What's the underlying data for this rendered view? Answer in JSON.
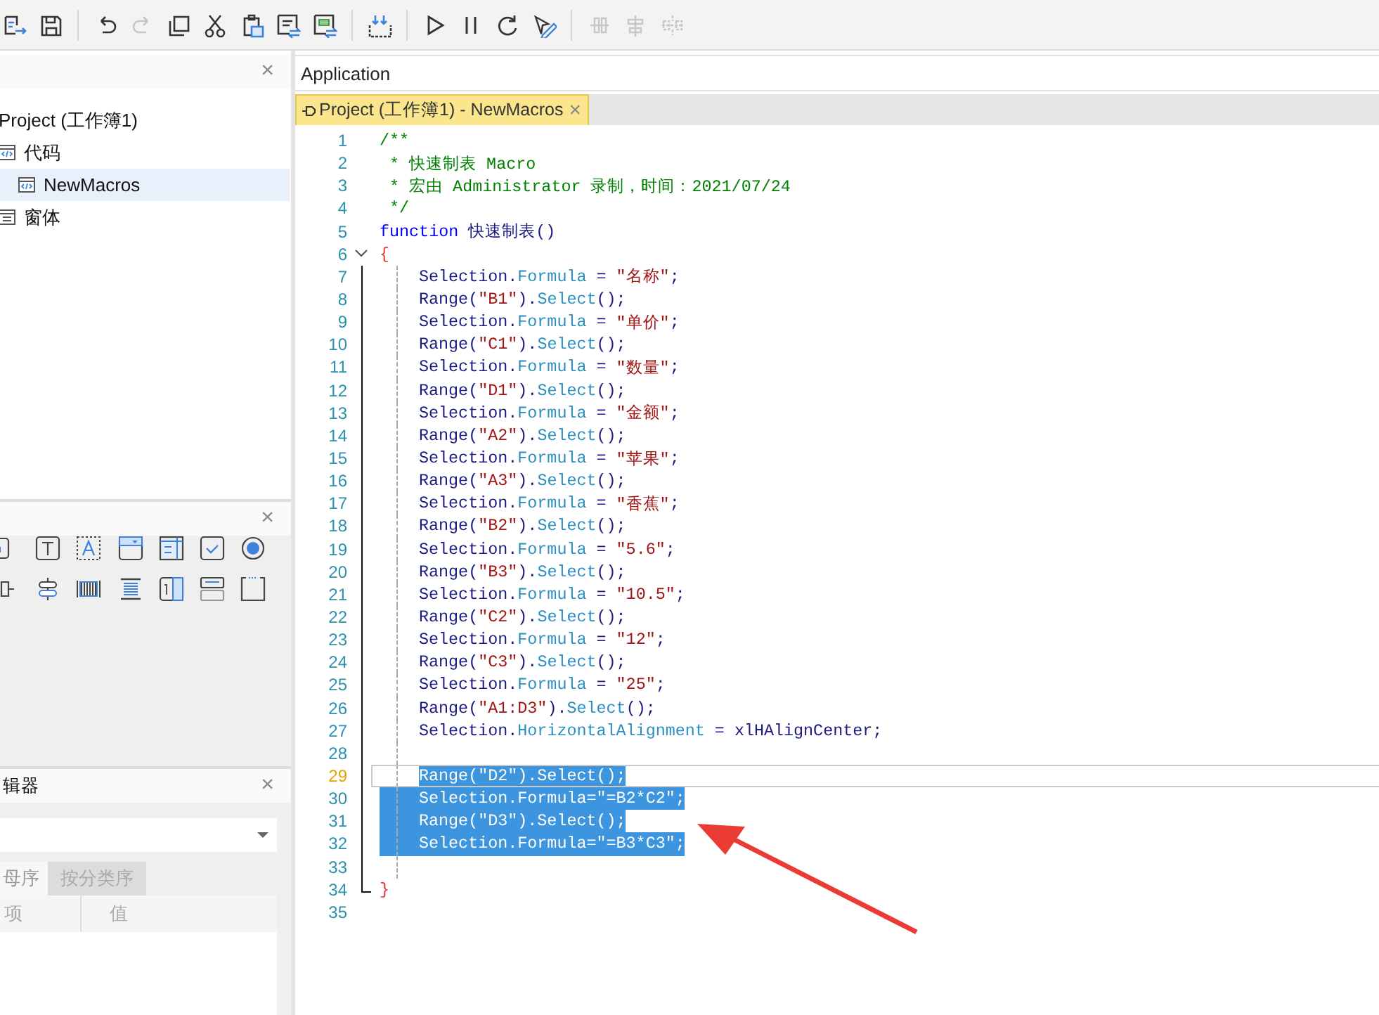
{
  "toolbar": {
    "groups": [
      [
        {
          "kind": "export",
          "disabled": false
        },
        {
          "kind": "save",
          "disabled": false
        }
      ],
      [
        {
          "kind": "undo",
          "disabled": false
        },
        {
          "kind": "redo",
          "disabled": true
        },
        {
          "kind": "copy",
          "disabled": false
        },
        {
          "kind": "cut",
          "disabled": false
        },
        {
          "kind": "paste",
          "disabled": false
        },
        {
          "kind": "comment",
          "disabled": false
        },
        {
          "kind": "uncomment",
          "disabled": false
        }
      ],
      [
        {
          "kind": "import",
          "disabled": false
        }
      ],
      [
        {
          "kind": "run",
          "disabled": false
        },
        {
          "kind": "pause",
          "disabled": false
        },
        {
          "kind": "reset",
          "disabled": false
        },
        {
          "kind": "design",
          "disabled": false
        }
      ],
      [
        {
          "kind": "align-h",
          "disabled": true
        },
        {
          "kind": "align-v",
          "disabled": true
        },
        {
          "kind": "distribute",
          "disabled": true
        }
      ]
    ]
  },
  "project_panel": {
    "close": "×",
    "tree": [
      {
        "label": "Project (工作簿1)",
        "selected": false,
        "children": [
          {
            "label": "代码",
            "kind": "module",
            "selected": false,
            "children": [
              {
                "label": "NewMacros",
                "kind": "module",
                "selected": true
              }
            ]
          },
          {
            "label": "窗体",
            "kind": "form",
            "selected": false
          }
        ]
      }
    ]
  },
  "toolbox_panel": {
    "close": "×",
    "tools": [
      {
        "kind": "button"
      },
      {
        "kind": "label"
      },
      {
        "kind": "textbox"
      },
      {
        "kind": "combobox"
      },
      {
        "kind": "listbox"
      },
      {
        "kind": "checkbox"
      },
      {
        "kind": "radio"
      },
      {
        "kind": "scrollbar"
      },
      {
        "kind": "spin"
      },
      {
        "kind": "hscroll"
      },
      {
        "kind": "vscroll"
      },
      {
        "kind": "number"
      },
      {
        "kind": "toggle"
      },
      {
        "kind": "frame"
      }
    ]
  },
  "property_panel": {
    "title": "辑器",
    "close": "×",
    "tabs": [
      {
        "label": "母序",
        "selected": true
      },
      {
        "label": "按分类序",
        "selected": false
      }
    ],
    "columns": [
      "项",
      "值"
    ]
  },
  "editor": {
    "header": "Application",
    "tab": {
      "label": "Project (工作簿1) - NewMacros",
      "close": "×"
    },
    "lines": [
      {
        "number": "1",
        "selected": false,
        "current": false,
        "tokens": [
          {
            "kind": "comment",
            "text": "/**"
          }
        ]
      },
      {
        "number": "2",
        "selected": false,
        "current": false,
        "tokens": [
          {
            "kind": "comment",
            "text": " * 快速制表 Macro"
          }
        ]
      },
      {
        "number": "3",
        "selected": false,
        "current": false,
        "tokens": [
          {
            "kind": "comment",
            "text": " * 宏由 Administrator 录制，时间：2021/07/24"
          }
        ]
      },
      {
        "number": "4",
        "selected": false,
        "current": false,
        "tokens": [
          {
            "kind": "comment",
            "text": " */"
          }
        ]
      },
      {
        "number": "5",
        "selected": false,
        "current": false,
        "tokens": [
          {
            "kind": "keyword",
            "text": "function"
          },
          {
            "kind": "name",
            "text": " 快速制表()"
          }
        ]
      },
      {
        "number": "6",
        "selected": false,
        "current": false,
        "expanded": true,
        "tokens": [
          {
            "kind": "brace",
            "text": "{"
          }
        ],
        "children": [
          {
            "number": "7",
            "selected": false,
            "current": false,
            "tokens": [
              {
                "kind": "ident",
                "text": "Selection."
              },
              {
                "kind": "prop",
                "text": "Formula"
              },
              {
                "kind": "ident",
                "text": " = "
              },
              {
                "kind": "string",
                "text": "\"名称\""
              },
              {
                "kind": "ident",
                "text": ";"
              }
            ]
          },
          {
            "number": "8",
            "selected": false,
            "current": false,
            "tokens": [
              {
                "kind": "ident",
                "text": "Range("
              },
              {
                "kind": "string",
                "text": "\"B1\""
              },
              {
                "kind": "ident",
                "text": ")."
              },
              {
                "kind": "prop",
                "text": "Select"
              },
              {
                "kind": "ident",
                "text": "();"
              }
            ]
          },
          {
            "number": "9",
            "selected": false,
            "current": false,
            "tokens": [
              {
                "kind": "ident",
                "text": "Selection."
              },
              {
                "kind": "prop",
                "text": "Formula"
              },
              {
                "kind": "ident",
                "text": " = "
              },
              {
                "kind": "string",
                "text": "\"单价\""
              },
              {
                "kind": "ident",
                "text": ";"
              }
            ]
          },
          {
            "number": "10",
            "selected": false,
            "current": false,
            "tokens": [
              {
                "kind": "ident",
                "text": "Range("
              },
              {
                "kind": "string",
                "text": "\"C1\""
              },
              {
                "kind": "ident",
                "text": ")."
              },
              {
                "kind": "prop",
                "text": "Select"
              },
              {
                "kind": "ident",
                "text": "();"
              }
            ]
          },
          {
            "number": "11",
            "selected": false,
            "current": false,
            "tokens": [
              {
                "kind": "ident",
                "text": "Selection."
              },
              {
                "kind": "prop",
                "text": "Formula"
              },
              {
                "kind": "ident",
                "text": " = "
              },
              {
                "kind": "string",
                "text": "\"数量\""
              },
              {
                "kind": "ident",
                "text": ";"
              }
            ]
          },
          {
            "number": "12",
            "selected": false,
            "current": false,
            "tokens": [
              {
                "kind": "ident",
                "text": "Range("
              },
              {
                "kind": "string",
                "text": "\"D1\""
              },
              {
                "kind": "ident",
                "text": ")."
              },
              {
                "kind": "prop",
                "text": "Select"
              },
              {
                "kind": "ident",
                "text": "();"
              }
            ]
          },
          {
            "number": "13",
            "selected": false,
            "current": false,
            "tokens": [
              {
                "kind": "ident",
                "text": "Selection."
              },
              {
                "kind": "prop",
                "text": "Formula"
              },
              {
                "kind": "ident",
                "text": " = "
              },
              {
                "kind": "string",
                "text": "\"金额\""
              },
              {
                "kind": "ident",
                "text": ";"
              }
            ]
          },
          {
            "number": "14",
            "selected": false,
            "current": false,
            "tokens": [
              {
                "kind": "ident",
                "text": "Range("
              },
              {
                "kind": "string",
                "text": "\"A2\""
              },
              {
                "kind": "ident",
                "text": ")."
              },
              {
                "kind": "prop",
                "text": "Select"
              },
              {
                "kind": "ident",
                "text": "();"
              }
            ]
          },
          {
            "number": "15",
            "selected": false,
            "current": false,
            "tokens": [
              {
                "kind": "ident",
                "text": "Selection."
              },
              {
                "kind": "prop",
                "text": "Formula"
              },
              {
                "kind": "ident",
                "text": " = "
              },
              {
                "kind": "string",
                "text": "\"苹果\""
              },
              {
                "kind": "ident",
                "text": ";"
              }
            ]
          },
          {
            "number": "16",
            "selected": false,
            "current": false,
            "tokens": [
              {
                "kind": "ident",
                "text": "Range("
              },
              {
                "kind": "string",
                "text": "\"A3\""
              },
              {
                "kind": "ident",
                "text": ")."
              },
              {
                "kind": "prop",
                "text": "Select"
              },
              {
                "kind": "ident",
                "text": "();"
              }
            ]
          },
          {
            "number": "17",
            "selected": false,
            "current": false,
            "tokens": [
              {
                "kind": "ident",
                "text": "Selection."
              },
              {
                "kind": "prop",
                "text": "Formula"
              },
              {
                "kind": "ident",
                "text": " = "
              },
              {
                "kind": "string",
                "text": "\"香蕉\""
              },
              {
                "kind": "ident",
                "text": ";"
              }
            ]
          },
          {
            "number": "18",
            "selected": false,
            "current": false,
            "tokens": [
              {
                "kind": "ident",
                "text": "Range("
              },
              {
                "kind": "string",
                "text": "\"B2\""
              },
              {
                "kind": "ident",
                "text": ")."
              },
              {
                "kind": "prop",
                "text": "Select"
              },
              {
                "kind": "ident",
                "text": "();"
              }
            ]
          },
          {
            "number": "19",
            "selected": false,
            "current": false,
            "tokens": [
              {
                "kind": "ident",
                "text": "Selection."
              },
              {
                "kind": "prop",
                "text": "Formula"
              },
              {
                "kind": "ident",
                "text": " = "
              },
              {
                "kind": "string",
                "text": "\"5.6\""
              },
              {
                "kind": "ident",
                "text": ";"
              }
            ]
          },
          {
            "number": "20",
            "selected": false,
            "current": false,
            "tokens": [
              {
                "kind": "ident",
                "text": "Range("
              },
              {
                "kind": "string",
                "text": "\"B3\""
              },
              {
                "kind": "ident",
                "text": ")."
              },
              {
                "kind": "prop",
                "text": "Select"
              },
              {
                "kind": "ident",
                "text": "();"
              }
            ]
          },
          {
            "number": "21",
            "selected": false,
            "current": false,
            "tokens": [
              {
                "kind": "ident",
                "text": "Selection."
              },
              {
                "kind": "prop",
                "text": "Formula"
              },
              {
                "kind": "ident",
                "text": " = "
              },
              {
                "kind": "string",
                "text": "\"10.5\""
              },
              {
                "kind": "ident",
                "text": ";"
              }
            ]
          },
          {
            "number": "22",
            "selected": false,
            "current": false,
            "tokens": [
              {
                "kind": "ident",
                "text": "Range("
              },
              {
                "kind": "string",
                "text": "\"C2\""
              },
              {
                "kind": "ident",
                "text": ")."
              },
              {
                "kind": "prop",
                "text": "Select"
              },
              {
                "kind": "ident",
                "text": "();"
              }
            ]
          },
          {
            "number": "23",
            "selected": false,
            "current": false,
            "tokens": [
              {
                "kind": "ident",
                "text": "Selection."
              },
              {
                "kind": "prop",
                "text": "Formula"
              },
              {
                "kind": "ident",
                "text": " = "
              },
              {
                "kind": "string",
                "text": "\"12\""
              },
              {
                "kind": "ident",
                "text": ";"
              }
            ]
          },
          {
            "number": "24",
            "selected": false,
            "current": false,
            "tokens": [
              {
                "kind": "ident",
                "text": "Range("
              },
              {
                "kind": "string",
                "text": "\"C3\""
              },
              {
                "kind": "ident",
                "text": ")."
              },
              {
                "kind": "prop",
                "text": "Select"
              },
              {
                "kind": "ident",
                "text": "();"
              }
            ]
          },
          {
            "number": "25",
            "selected": false,
            "current": false,
            "tokens": [
              {
                "kind": "ident",
                "text": "Selection."
              },
              {
                "kind": "prop",
                "text": "Formula"
              },
              {
                "kind": "ident",
                "text": " = "
              },
              {
                "kind": "string",
                "text": "\"25\""
              },
              {
                "kind": "ident",
                "text": ";"
              }
            ]
          },
          {
            "number": "26",
            "selected": false,
            "current": false,
            "tokens": [
              {
                "kind": "ident",
                "text": "Range("
              },
              {
                "kind": "string",
                "text": "\"A1:D3\""
              },
              {
                "kind": "ident",
                "text": ")."
              },
              {
                "kind": "prop",
                "text": "Select"
              },
              {
                "kind": "ident",
                "text": "();"
              }
            ]
          },
          {
            "number": "27",
            "selected": false,
            "current": false,
            "tokens": [
              {
                "kind": "ident",
                "text": "Selection."
              },
              {
                "kind": "prop",
                "text": "HorizontalAlignment"
              },
              {
                "kind": "ident",
                "text": " = xlHAlignCenter;"
              }
            ]
          },
          {
            "number": "28",
            "selected": false,
            "current": false
          },
          {
            "number": "29",
            "selected": true,
            "current": true,
            "text": "Range(\"D2\").Select();"
          },
          {
            "number": "30",
            "selected": true,
            "current": false,
            "text": "Selection.Formula=\"=B2*C2\";"
          },
          {
            "number": "31",
            "selected": true,
            "current": false,
            "text": "Range(\"D3\").Select();"
          },
          {
            "number": "32",
            "selected": true,
            "current": false,
            "text": "Selection.Formula=\"=B3*C3\";"
          },
          {
            "number": "33",
            "selected": false,
            "current": false
          }
        ]
      },
      {
        "number": "34",
        "selected": false,
        "current": false,
        "tokens": [
          {
            "kind": "brace",
            "text": "}"
          }
        ]
      },
      {
        "number": "35",
        "selected": false,
        "current": false
      }
    ]
  }
}
